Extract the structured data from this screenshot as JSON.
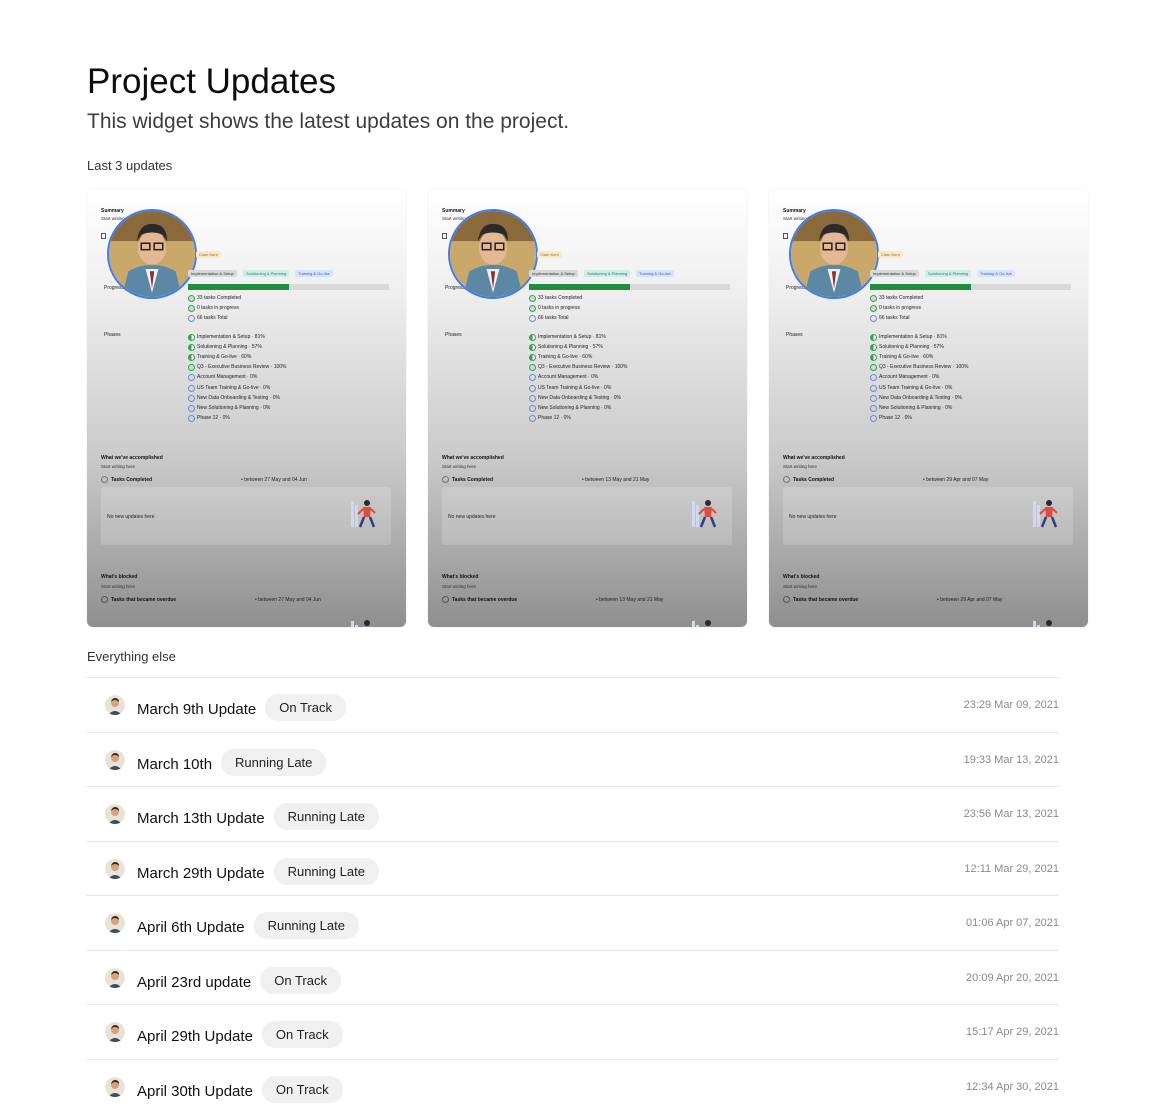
{
  "header": {
    "title": "Project Updates",
    "subtitle": "This widget shows the latest updates on the project."
  },
  "recent": {
    "label": "Last 3 updates",
    "card_text": {
      "summary": "Summary",
      "start_writing": "Start writing here",
      "owner": "Clark Kent",
      "progress_label": "Progress",
      "tags": [
        "Implementation & Setup",
        "Solutioning & Planning",
        "Training & Go-live"
      ],
      "completed": "33 tasks Completed",
      "in_progress": "0 tasks in progress",
      "total": "66 tasks Total",
      "phases_label": "Phases",
      "phases": [
        "Implementation & Setup · 81%",
        "Solutioning & Planning · 57%",
        "Training & Go-live · 60%",
        "Q3 - Executive Business Review · 100%",
        "Account Management · 0%",
        "US Team Training & Go-live · 0%",
        "New Data Onboarding & Testing · 0%",
        "New Solutioning & Planning · 0%",
        "Phase 12 · 0%"
      ],
      "accomplished_heading": "What we've accomplished",
      "tasks_completed": "Tasks Completed",
      "no_updates": "No new updates here",
      "blocked_heading": "What's blocked",
      "tasks_overdue": "Tasks that became overdue"
    },
    "cards": [
      {
        "range_done": "• between 27 May and 04 Jun",
        "range_overdue": "• between 27 May and 04 Jun"
      },
      {
        "range_done": "• between 13 May and 21 May",
        "range_overdue": "• between 13 May and 21 May"
      },
      {
        "range_done": "• between 29 Apr and 07 May",
        "range_overdue": "• between 29 Apr and 07 May"
      }
    ]
  },
  "others": {
    "label": "Everything else",
    "rows": [
      {
        "title": "March 9th Update",
        "status": "On Track",
        "time": "23:29 Mar 09, 2021"
      },
      {
        "title": "March 10th",
        "status": "Running Late",
        "time": "19:33 Mar 13, 2021"
      },
      {
        "title": "March 13th Update",
        "status": "Running Late",
        "time": "23:56 Mar 13, 2021"
      },
      {
        "title": "March 29th Update",
        "status": "Running Late",
        "time": "12:11 Mar 29, 2021"
      },
      {
        "title": "April 6th Update",
        "status": "Running Late",
        "time": "01:06 Apr 07, 2021"
      },
      {
        "title": "April 23rd update",
        "status": "On Track",
        "time": "20:09 Apr 20, 2021"
      },
      {
        "title": "April 29th Update",
        "status": "On Track",
        "time": "15:17 Apr 29, 2021"
      },
      {
        "title": "April 30th Update",
        "status": "On Track",
        "time": "12:34 Apr 30, 2021"
      }
    ]
  },
  "colors": {
    "avatar_ring": "#3f7cf2",
    "progress_fill": "#1f8f3f"
  }
}
